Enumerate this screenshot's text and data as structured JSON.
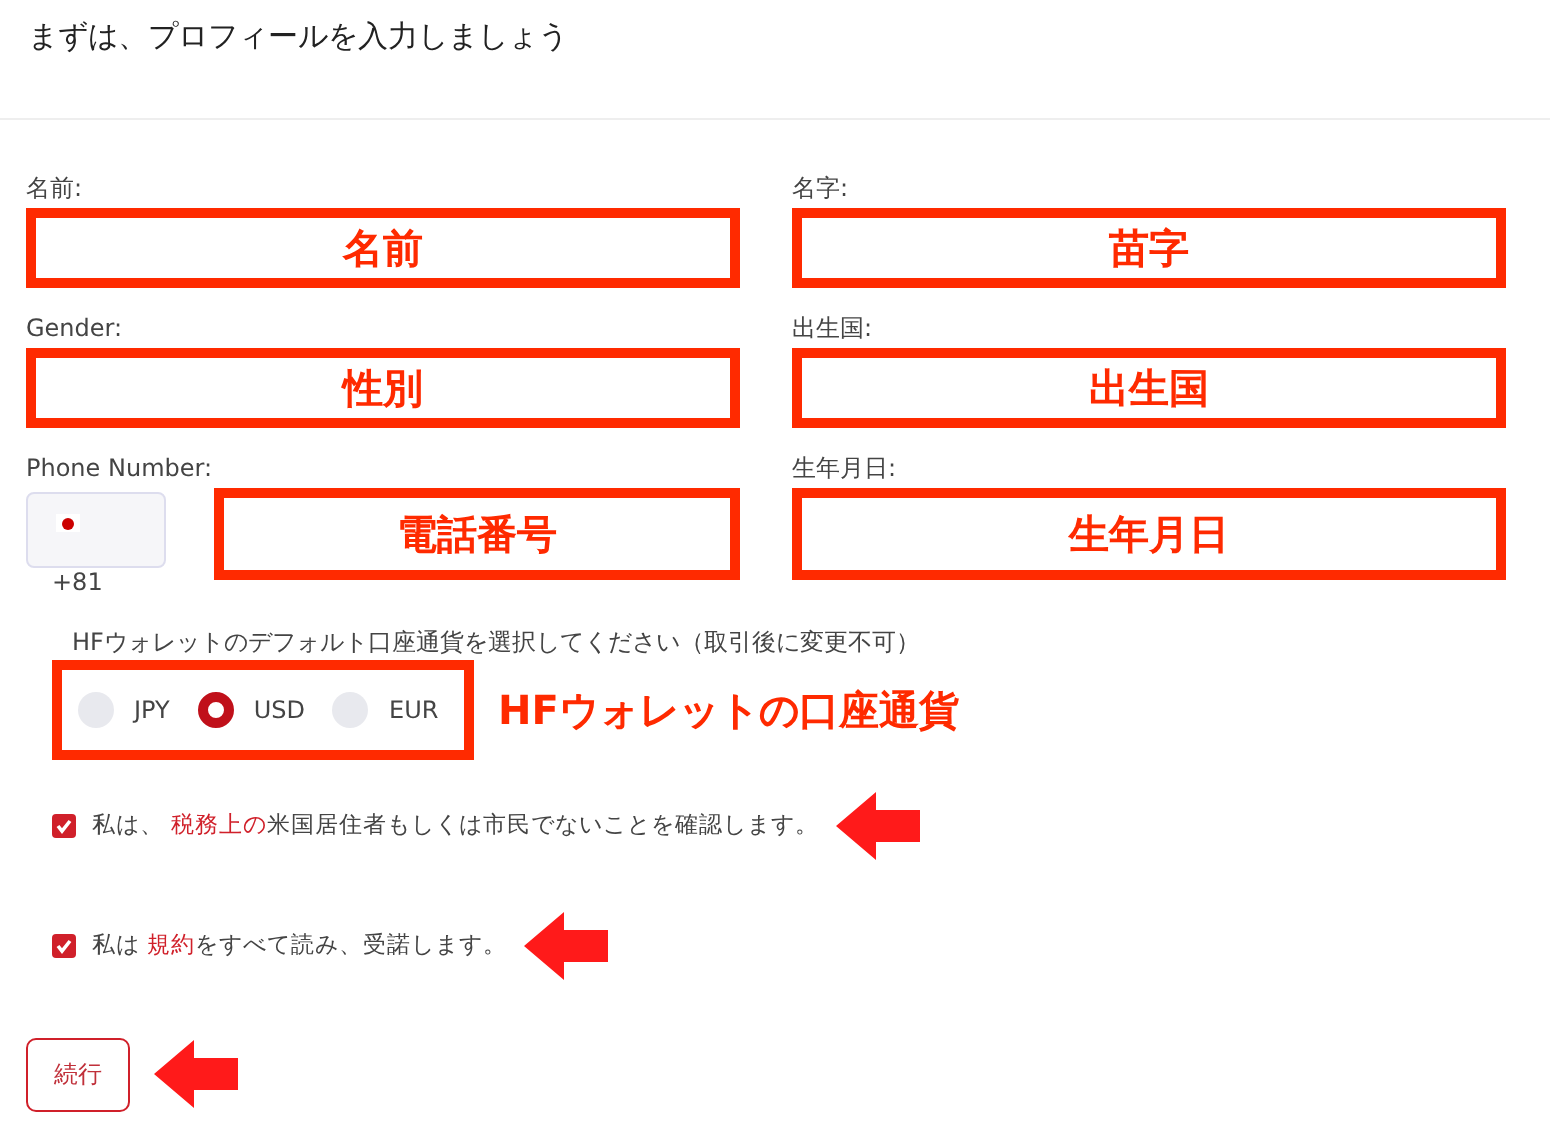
{
  "header": {
    "title": "まずは、プロフィールを入力しましょう"
  },
  "fields": [
    {
      "label": "名前:",
      "annotation": "名前"
    },
    {
      "label": "名字:",
      "annotation": "苗字"
    },
    {
      "label": "Gender:",
      "annotation": "性別"
    },
    {
      "label": "出生国:",
      "annotation": "出生国"
    },
    {
      "label": "Phone Number:",
      "annotation": "電話番号",
      "kind": "phone",
      "country_code": "+81"
    },
    {
      "label": "生年月日:",
      "annotation": "生年月日"
    }
  ],
  "currency": {
    "label": "HFウォレットのデフォルト口座通貨を選択してください（取引後に変更不可）",
    "annotation": "HFウォレットの口座通貨",
    "options": [
      {
        "label": "JPY",
        "selected": false
      },
      {
        "label": "USD",
        "selected": true
      },
      {
        "label": "EUR",
        "selected": false
      }
    ]
  },
  "agreements": [
    {
      "checked": true,
      "before": "私は、 ",
      "link": "税務上の",
      "after": "米国居住者もしくは市民でないことを確認します。"
    },
    {
      "checked": true,
      "before": "私は ",
      "link": "規約",
      "after": "をすべて読み、受諾します。"
    }
  ],
  "continue_button": "続行"
}
